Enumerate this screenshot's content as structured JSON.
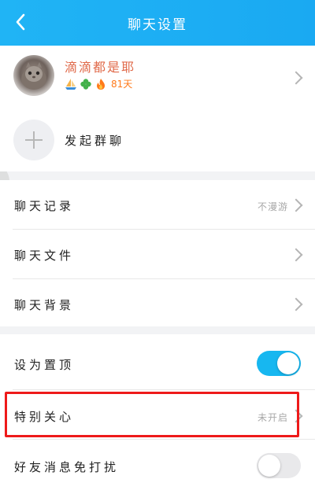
{
  "header": {
    "title": "聊天设置",
    "bg_color": "#1eb0f4"
  },
  "profile": {
    "nickname": "滴滴都是耶",
    "badges": [
      "sailboat-icon",
      "clover-icon",
      "flame-icon"
    ],
    "days_text": "81天"
  },
  "group_chat": {
    "label": "发起群聊"
  },
  "menu": {
    "chat_history": {
      "label": "聊天记录",
      "value": "不漫游"
    },
    "chat_files": {
      "label": "聊天文件"
    },
    "chat_background": {
      "label": "聊天背景"
    }
  },
  "settings": {
    "pin_top": {
      "label": "设为置顶",
      "enabled": true
    },
    "special_care": {
      "label": "特别关心",
      "value": "未开启"
    },
    "do_not_disturb": {
      "label": "好友消息免打扰",
      "enabled": false
    }
  },
  "colors": {
    "toggle_on": "#17b7f0",
    "highlight": "#ee1a1a",
    "nickname": "#e06a4a"
  }
}
